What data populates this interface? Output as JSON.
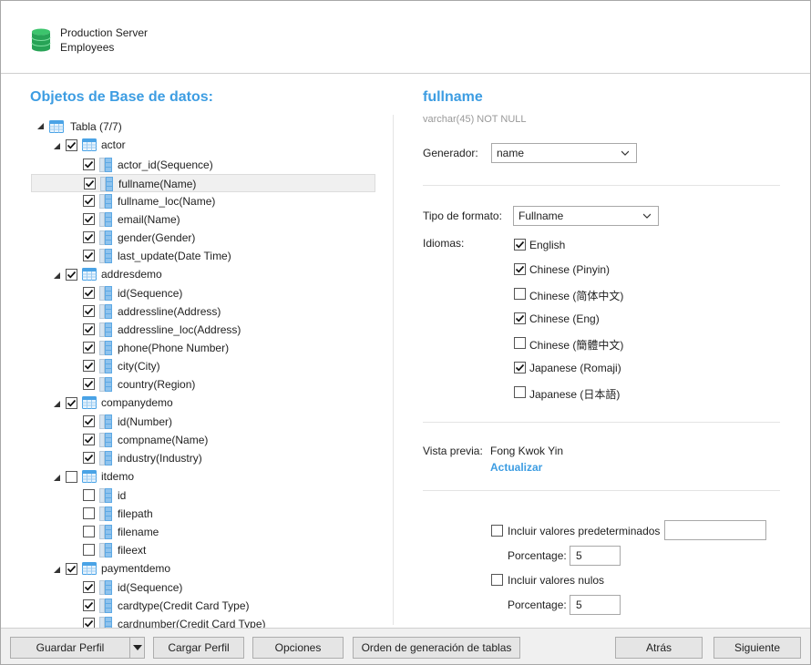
{
  "header": {
    "connection": "Production Server",
    "database": "Employees"
  },
  "left": {
    "title": "Objetos de Base de datos:",
    "root": {
      "label": "Tabla (7/7)"
    },
    "tables": [
      {
        "name": "actor",
        "checked": true,
        "columns": [
          {
            "label": "actor_id(Sequence)",
            "checked": true
          },
          {
            "label": "fullname(Name)",
            "checked": true,
            "selected": true
          },
          {
            "label": "fullname_loc(Name)",
            "checked": true
          },
          {
            "label": "email(Name)",
            "checked": true
          },
          {
            "label": "gender(Gender)",
            "checked": true
          },
          {
            "label": "last_update(Date Time)",
            "checked": true
          }
        ]
      },
      {
        "name": "addresdemo",
        "checked": true,
        "columns": [
          {
            "label": "id(Sequence)",
            "checked": true
          },
          {
            "label": "addressline(Address)",
            "checked": true
          },
          {
            "label": "addressline_loc(Address)",
            "checked": true
          },
          {
            "label": "phone(Phone Number)",
            "checked": true
          },
          {
            "label": "city(City)",
            "checked": true
          },
          {
            "label": "country(Region)",
            "checked": true
          }
        ]
      },
      {
        "name": "companydemo",
        "checked": true,
        "columns": [
          {
            "label": "id(Number)",
            "checked": true
          },
          {
            "label": "compname(Name)",
            "checked": true
          },
          {
            "label": "industry(Industry)",
            "checked": true
          }
        ]
      },
      {
        "name": "itdemo",
        "checked": false,
        "columns": [
          {
            "label": "id",
            "checked": false
          },
          {
            "label": "filepath",
            "checked": false
          },
          {
            "label": "filename",
            "checked": false
          },
          {
            "label": "fileext",
            "checked": false
          }
        ]
      },
      {
        "name": "paymentdemo",
        "checked": true,
        "columns": [
          {
            "label": "id(Sequence)",
            "checked": true
          },
          {
            "label": "cardtype(Credit Card Type)",
            "checked": true
          },
          {
            "label": "cardnumber(Credit Card Type)",
            "checked": true
          }
        ]
      }
    ]
  },
  "right": {
    "field_name": "fullname",
    "field_type": "varchar(45) NOT NULL",
    "generator_label": "Generador:",
    "generator_value": "name",
    "format_label": "Tipo de formato:",
    "format_value": "Fullname",
    "languages_label": "Idiomas:",
    "languages": [
      {
        "label": "English",
        "checked": true
      },
      {
        "label": "Chinese (Pinyin)",
        "checked": true
      },
      {
        "label": "Chinese (简体中文)",
        "checked": false
      },
      {
        "label": "Chinese (Eng)",
        "checked": true
      },
      {
        "label": "Chinese (簡體中文)",
        "checked": false
      },
      {
        "label": "Japanese (Romaji)",
        "checked": true
      },
      {
        "label": "Japanese (日本語)",
        "checked": false
      }
    ],
    "preview_label": "Vista previa:",
    "preview_value": "Fong Kwok Yin",
    "refresh_link": "Actualizar",
    "include_defaults_label": "Incluir valores predeterminados",
    "include_defaults_checked": false,
    "include_defaults_value": "",
    "percentage_label_1": "Porcentage:",
    "percentage_value_1": "5",
    "include_nulls_label": "Incluir valores nulos",
    "include_nulls_checked": false,
    "percentage_label_2": "Porcentage:",
    "percentage_value_2": "5"
  },
  "footer": {
    "save_profile": "Guardar Perfil",
    "load_profile": "Cargar Perfil",
    "options": "Opciones",
    "table_order": "Orden de generación de tablas",
    "back": "Atrás",
    "next": "Siguiente"
  },
  "colors": {
    "accent": "#3d9de2",
    "db_icon": "#2eaa5c"
  }
}
